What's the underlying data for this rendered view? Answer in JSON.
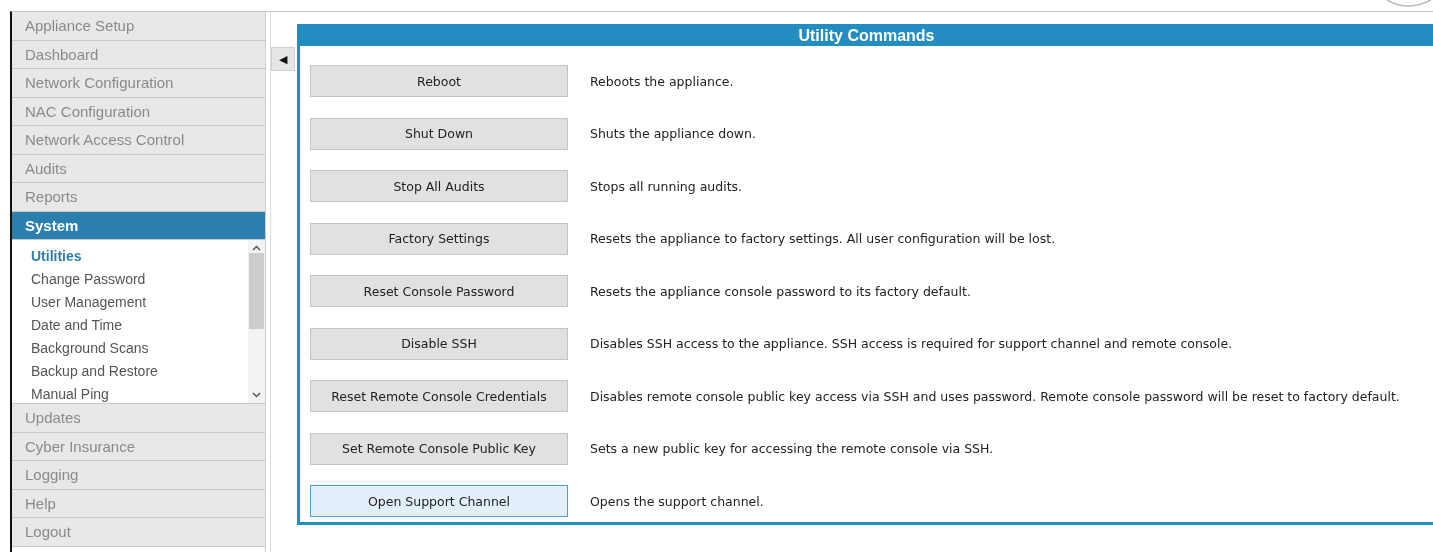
{
  "sidebar": {
    "items": [
      {
        "label": "Appliance Setup",
        "selected": false
      },
      {
        "label": "Dashboard",
        "selected": false
      },
      {
        "label": "Network Configuration",
        "selected": false
      },
      {
        "label": "NAC Configuration",
        "selected": false
      },
      {
        "label": "Network Access Control",
        "selected": false
      },
      {
        "label": "Audits",
        "selected": false
      },
      {
        "label": "Reports",
        "selected": false
      },
      {
        "label": "System",
        "selected": true,
        "expanded": true,
        "children": [
          {
            "label": "Utilities",
            "selected": true
          },
          {
            "label": "Change Password",
            "selected": false
          },
          {
            "label": "User Management",
            "selected": false
          },
          {
            "label": "Date and Time",
            "selected": false
          },
          {
            "label": "Background Scans",
            "selected": false
          },
          {
            "label": "Backup and Restore",
            "selected": false
          },
          {
            "label": "Manual Ping",
            "selected": false
          }
        ]
      },
      {
        "label": "Updates",
        "selected": false
      },
      {
        "label": "Cyber Insurance",
        "selected": false
      },
      {
        "label": "Logging",
        "selected": false
      },
      {
        "label": "Help",
        "selected": false
      },
      {
        "label": "Logout",
        "selected": false
      }
    ]
  },
  "collapse_button": "◀",
  "panel": {
    "title": "Utility Commands",
    "commands": [
      {
        "label": "Reboot",
        "description": "Reboots the appliance.",
        "focused": false
      },
      {
        "label": "Shut Down",
        "description": "Shuts the appliance down.",
        "focused": false
      },
      {
        "label": "Stop All Audits",
        "description": "Stops all running audits.",
        "focused": false
      },
      {
        "label": "Factory Settings",
        "description": "Resets the appliance to factory settings. All user configuration will be lost.",
        "focused": false
      },
      {
        "label": "Reset Console Password",
        "description": "Resets the appliance console password to its factory default.",
        "focused": false
      },
      {
        "label": "Disable SSH",
        "description": "Disables SSH access to the appliance. SSH access is required for support channel and remote console.",
        "focused": false
      },
      {
        "label": "Reset Remote Console Credentials",
        "description": "Disables remote console public key access via SSH and uses password. Remote console password will be reset to factory default.",
        "focused": false
      },
      {
        "label": "Set Remote Console Public Key",
        "description": "Sets a new public key for accessing the remote console via SSH.",
        "focused": false
      },
      {
        "label": "Open Support Channel",
        "description": "Opens the support channel.",
        "focused": true
      }
    ]
  }
}
